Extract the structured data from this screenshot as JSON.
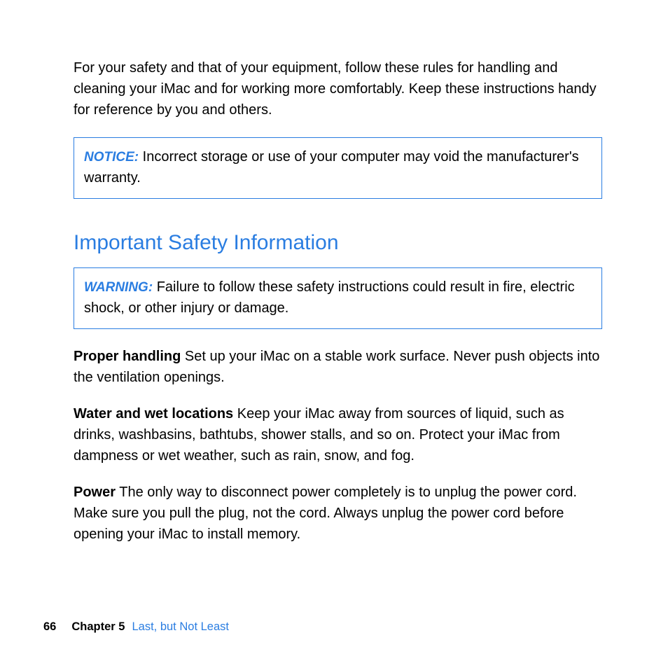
{
  "intro": "For your safety and that of your equipment, follow these rules for handling and cleaning your iMac and for working more comfortably. Keep these instructions handy for reference by you and others.",
  "notice": {
    "label": "NOTICE:",
    "text": "  Incorrect storage or use of your computer may void the manufacturer's warranty."
  },
  "heading": "Important Safety Information",
  "warning": {
    "label": "WARNING:",
    "text": "  Failure to follow these safety instructions could result in fire, electric shock, or other injury or damage."
  },
  "sections": [
    {
      "label": "Proper handling",
      "text": "  Set up your iMac on a stable work surface. Never push objects into the ventilation openings."
    },
    {
      "label": "Water and wet locations",
      "text": "  Keep your iMac away from sources of liquid, such as drinks, washbasins, bathtubs, shower stalls, and so on. Protect your iMac from dampness or wet weather, such as rain, snow, and fog."
    },
    {
      "label": "Power",
      "text": "  The only way to disconnect power completely is to unplug the power cord. Make sure you pull the plug, not the cord. Always unplug the power cord before opening your iMac to install memory."
    }
  ],
  "footer": {
    "page": "66",
    "chapter_label": "Chapter 5",
    "chapter_title": "Last, but Not Least"
  }
}
